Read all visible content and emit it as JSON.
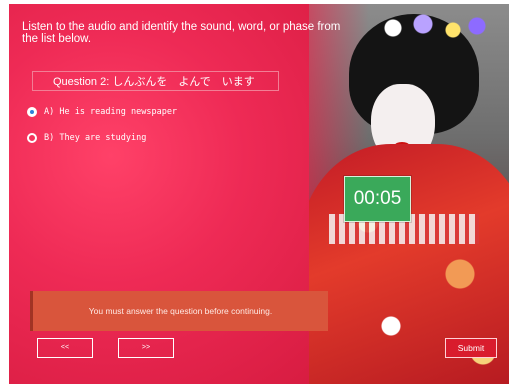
{
  "quiz": {
    "instruction": "Listen to the audio and identify the sound, word, or phase from the list below.",
    "question_label": "Question 2: しんぶんを　よんで　います",
    "options": [
      {
        "label": "A) He is reading newspaper",
        "selected": true
      },
      {
        "label": "B) They are studying",
        "selected": false
      }
    ],
    "timer": "00:05",
    "alert_message": "You must answer the question before continuing.",
    "prev_label": "<<",
    "next_label": ">>",
    "submit_label": "Submit"
  },
  "colors": {
    "background_red": "#e8234a",
    "timer_green": "#3aa95a",
    "alert_orange": "#d9553c",
    "submit_red": "#d91c2d",
    "radio_selected": "#2f7fd9"
  }
}
